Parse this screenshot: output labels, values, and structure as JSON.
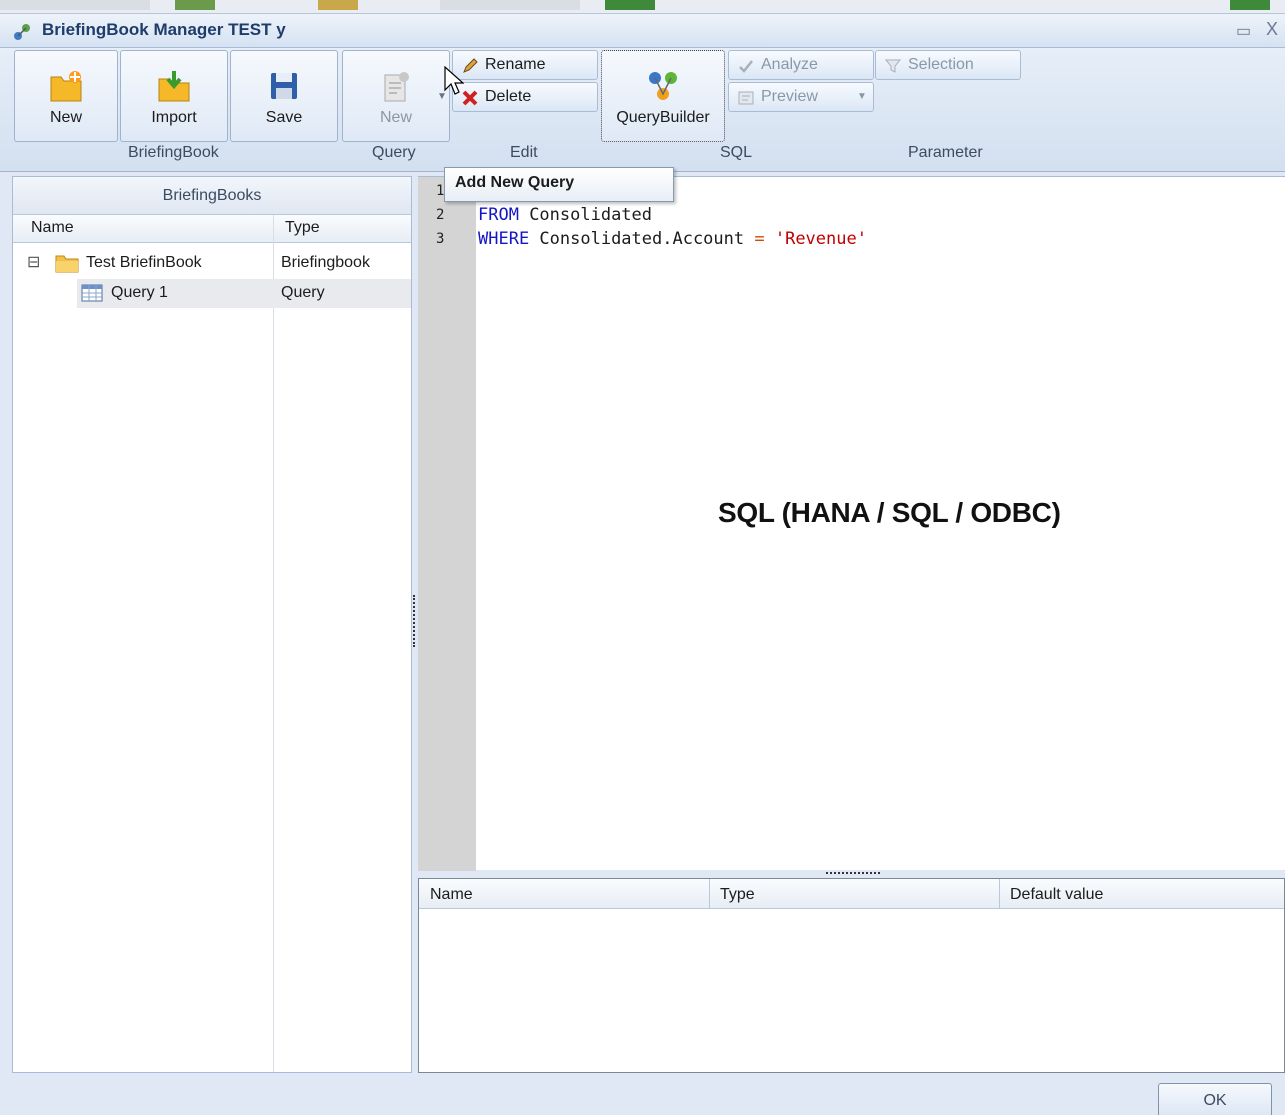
{
  "window": {
    "title": "BriefingBook Manager TEST y",
    "minimize_glyph": "▭",
    "close_glyph": "X"
  },
  "ribbon": {
    "briefingbook": {
      "group_label": "BriefingBook",
      "new_label": "New",
      "import_label": "Import",
      "save_label": "Save"
    },
    "query": {
      "group_label": "Query",
      "new_label": "New"
    },
    "edit": {
      "group_label": "Edit",
      "rename_label": "Rename",
      "delete_label": "Delete"
    },
    "sql": {
      "group_label": "SQL",
      "querybuilder_label": "QueryBuilder",
      "analyze_label": "Analyze",
      "preview_label": "Preview"
    },
    "parameter": {
      "group_label": "Parameter",
      "selection_label": "Selection"
    }
  },
  "tooltip": {
    "text": "Add New Query"
  },
  "left_panel": {
    "header": "BriefingBooks",
    "columns": [
      "Name",
      "Type"
    ],
    "rows": [
      {
        "name": "Test BriefinBook",
        "type": "Briefingbook",
        "expand_glyph": "⊟",
        "icon": "folder-icon"
      },
      {
        "name": "Query 1",
        "type": "Query",
        "icon": "table-icon"
      }
    ]
  },
  "editor": {
    "line_numbers": [
      "1",
      "2",
      "3"
    ],
    "lines": [
      {
        "kw": "FROM",
        "rest": " Consolidated"
      },
      {
        "kw": "WHERE",
        "rest": " Consolidated.Account ",
        "op": "=",
        "str": " 'Revenue'"
      }
    ],
    "overlay_label": "SQL (HANA / SQL / ODBC)"
  },
  "parameters_table": {
    "columns": [
      "Name",
      "Type",
      "Default value"
    ]
  },
  "footer": {
    "ok_label": "OK"
  },
  "colors": {
    "keyword": "#1515c8",
    "string": "#c00000",
    "operator": "#d04a00",
    "title_text": "#1f3d6b"
  }
}
